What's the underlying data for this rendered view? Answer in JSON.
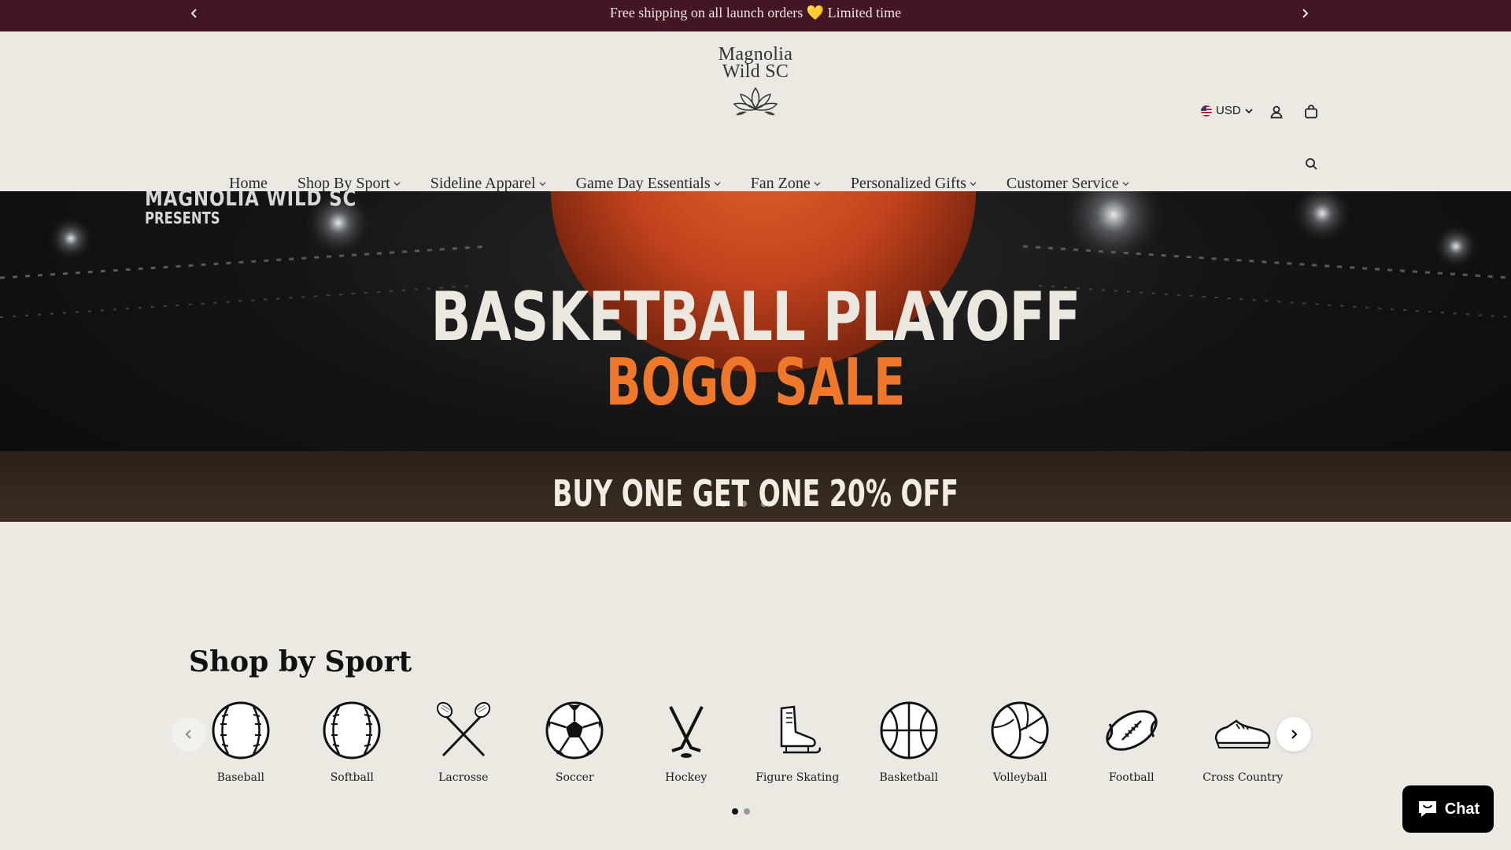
{
  "announcement": {
    "message": "Free shipping on all launch orders 💛 Limited time",
    "prev_icon": "chevron-left-icon",
    "next_icon": "chevron-right-icon"
  },
  "header": {
    "logo_text_line1": "Magnolia",
    "logo_text_line2": "Wild SC",
    "currency": "USD",
    "icons": [
      "flag-icon",
      "chevron-down-icon",
      "account-icon",
      "cart-icon",
      "search-icon"
    ]
  },
  "nav": {
    "items": [
      {
        "label": "Home",
        "dropdown": false
      },
      {
        "label": "Shop By Sport",
        "dropdown": true
      },
      {
        "label": "Sideline Apparel",
        "dropdown": true
      },
      {
        "label": "Game Day Essentials",
        "dropdown": true
      },
      {
        "label": "Fan Zone",
        "dropdown": true
      },
      {
        "label": "Personalized Gifts",
        "dropdown": true
      },
      {
        "label": "Customer Service",
        "dropdown": true
      }
    ]
  },
  "hero": {
    "brand": "MAGNOLIA WILD SC",
    "presents": "PRESENTS",
    "headline": "BASKETBALL PLAYOFF",
    "subheadline": "BOGO SALE",
    "deal": "BUY ONE GET ONE 20% OFF"
  },
  "shop_by_sport": {
    "title": "Shop by Sport",
    "sports": [
      {
        "label": "Baseball",
        "icon": "baseball-icon"
      },
      {
        "label": "Softball",
        "icon": "softball-icon"
      },
      {
        "label": "Lacrosse",
        "icon": "lacrosse-icon"
      },
      {
        "label": "Soccer",
        "icon": "soccer-ball-icon"
      },
      {
        "label": "Hockey",
        "icon": "hockey-sticks-icon"
      },
      {
        "label": "Figure Skating",
        "icon": "ice-skate-icon"
      },
      {
        "label": "Basketball",
        "icon": "basketball-icon"
      },
      {
        "label": "Volleyball",
        "icon": "volleyball-icon"
      },
      {
        "label": "Football",
        "icon": "football-icon"
      },
      {
        "label": "Cross Country",
        "icon": "running-shoe-icon"
      }
    ],
    "page_count": 2,
    "current_page": 1
  },
  "chat": {
    "label": "Chat",
    "icon": "chat-bubble-icon"
  },
  "colors": {
    "announcement_bg": "#431624",
    "page_bg": "#ece9e3",
    "accent_orange": "#f0782a",
    "chat_bg": "#000000"
  }
}
